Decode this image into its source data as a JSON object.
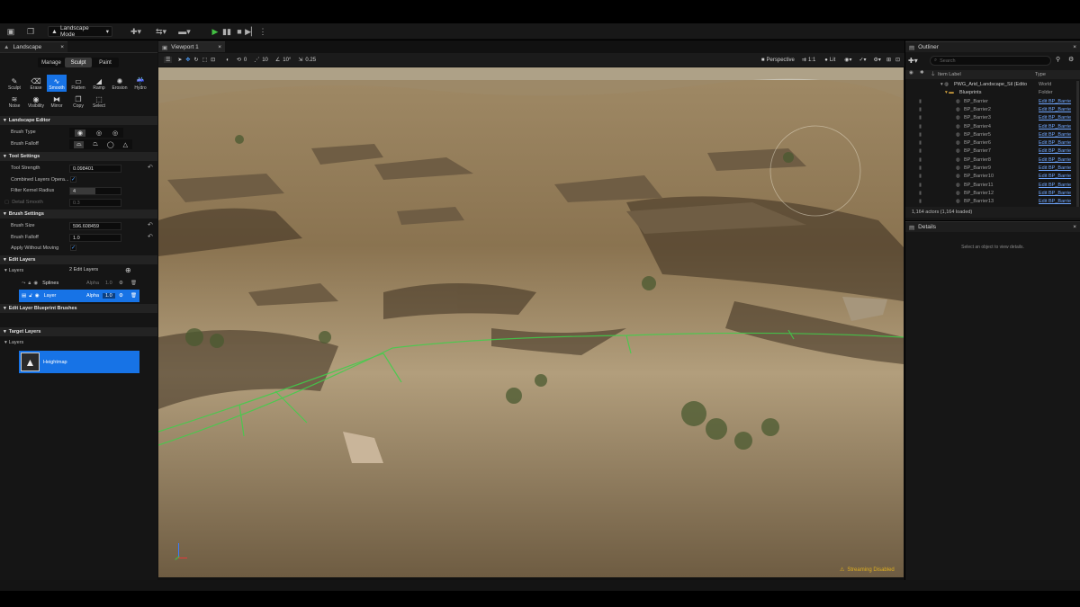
{
  "toolbar": {
    "mode": "Landscape Mode"
  },
  "landscape_panel": {
    "tab": "Landscape",
    "modes": [
      "Manage",
      "Sculpt",
      "Paint"
    ],
    "tools": [
      "Sculpt",
      "Erase",
      "Smooth",
      "Flatten",
      "Ramp",
      "Erosion",
      "Hydro",
      "Noise",
      "Visibility",
      "Mirror",
      "Copy",
      "Select"
    ],
    "landscape_editor": {
      "title": "Landscape Editor",
      "brush_type_label": "Brush Type",
      "brush_falloff_label": "Brush Falloff"
    },
    "tool_settings": {
      "title": "Tool Settings",
      "tool_strength_label": "Tool Strength",
      "tool_strength": "0.098401",
      "combined_layers_label": "Combined Layers Opera...",
      "filter_kernel_label": "Filter Kernel Radius",
      "filter_kernel": "4",
      "detail_smooth_label": "Detail Smooth",
      "detail_smooth": "0.3"
    },
    "brush_settings": {
      "title": "Brush Settings",
      "brush_size_label": "Brush Size",
      "brush_size": "596.608459",
      "brush_falloff_label": "Brush Falloff",
      "brush_falloff": "1.0",
      "apply_without_moving_label": "Apply Without Moving"
    },
    "edit_layers": {
      "title": "Edit Layers",
      "layers_label": "Layers",
      "count": "2 Edit Layers",
      "rows": [
        {
          "name": "Splines",
          "alpha_label": "Alpha",
          "alpha": "1.0"
        },
        {
          "name": "Layer",
          "alpha_label": "Alpha",
          "alpha": "1.0"
        }
      ]
    },
    "blueprint_brushes_title": "Edit Layer Blueprint Brushes",
    "target_layers": {
      "title": "Target Layers",
      "layers_label": "Layers",
      "heightmap": "Heightmap"
    }
  },
  "viewport": {
    "tab": "Viewport 1",
    "toolbar": {
      "rotation_value": "0",
      "scale_value": "10",
      "angle_value": "10°",
      "snap_value": "0.25",
      "perspective": "Perspective",
      "camera_speed": "1:1",
      "lit": "Lit"
    },
    "status": "Streaming Disabled"
  },
  "outliner": {
    "tab": "Outliner",
    "search_placeholder": "Search",
    "col_label": "Item Label",
    "col_type": "Type",
    "world": {
      "name": "PWG_Arid_Landscape_Sil (Edito",
      "type": "World"
    },
    "folder": {
      "name": "Blueprints",
      "type": "Folder"
    },
    "edit_label": "Edit BP_Barrie",
    "items": [
      "BP_Barrier",
      "BP_Barrier2",
      "BP_Barrier3",
      "BP_Barrier4",
      "BP_Barrier5",
      "BP_Barrier6",
      "BP_Barrier7",
      "BP_Barrier8",
      "BP_Barrier9",
      "BP_Barrier10",
      "BP_Barrier11",
      "BP_Barrier12",
      "BP_Barrier13"
    ],
    "actor_count": "1,164 actors (1,164 loaded)"
  },
  "details": {
    "tab": "Details",
    "empty_hint": "Select an object to view details."
  },
  "colors": {
    "accent": "#1773e6",
    "spline": "#3fd04a",
    "link": "#6fa6ff",
    "warning": "#e0b020"
  }
}
